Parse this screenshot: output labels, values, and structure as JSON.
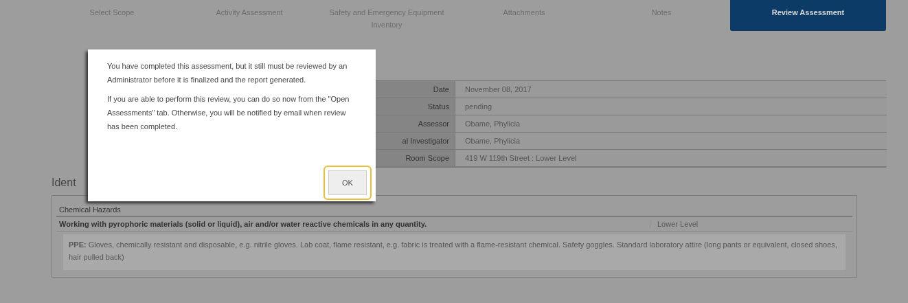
{
  "tabs": [
    {
      "label": "Select Scope",
      "selected": false
    },
    {
      "label": "Activity Assessment",
      "selected": false
    },
    {
      "label": "Safety and Emergency Equipment Inventory",
      "selected": false
    },
    {
      "label": "Attachments",
      "selected": false
    },
    {
      "label": "Notes",
      "selected": false
    },
    {
      "label": "Review Assessment",
      "selected": true
    }
  ],
  "summary": [
    {
      "label": "Date",
      "value": "November 08, 2017"
    },
    {
      "label": "Status",
      "value": "pending"
    },
    {
      "label": "Assessor",
      "value": "Obame, Phylicia"
    },
    {
      "label": "al Investigator",
      "value": "Obame, Phylicia"
    },
    {
      "label": "Room Scope",
      "value": "419 W 119th Street : Lower Level"
    }
  ],
  "section_heading": "Ident",
  "hazards": {
    "category": "Chemical Hazards",
    "rows": [
      {
        "activity": "Working with pyrophoric materials (solid or liquid), air and/or water reactive chemicals in any quantity.",
        "location": "Lower Level",
        "ppe": "**PPE:** Gloves, chemically resistant and disposable, e.g. nitrile gloves. Lab coat, flame resistant, e.g. fabric is treated with a flame-resistant chemical. Safety goggles. Standard laboratory attire (long pants or equivalent, closed shoes, hair pulled back)"
      }
    ]
  },
  "dialog": {
    "paragraphs": [
      "You have completed this assessment, but it still must be reviewed by an Administrator before it is finalized and the report generated.",
      "If you are able to perform this review, you can do so now from the \"Open Assessments\" tab. Otherwise, you will be notified by email when review has been completed."
    ],
    "button": {
      "label": "OK",
      "focused": true
    }
  }
}
